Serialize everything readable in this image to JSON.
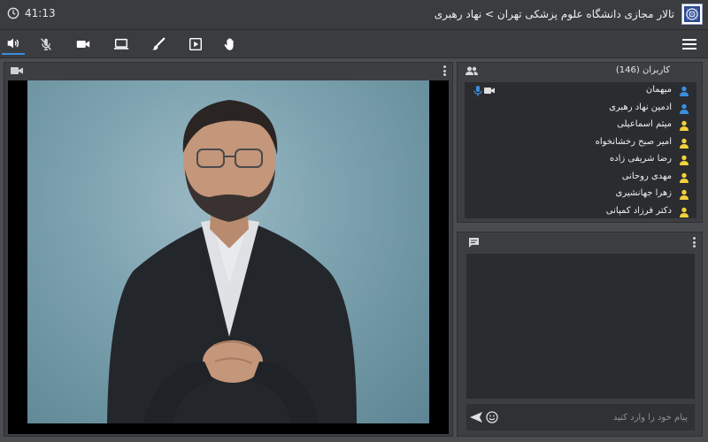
{
  "header": {
    "timer": "41:13",
    "title": "تالار مجازی دانشگاه علوم پزشکی تهران > نهاد رهبری"
  },
  "toolbar": {
    "items": [
      {
        "icon": "speaker-icon",
        "active": true
      },
      {
        "icon": "mic-off-icon",
        "active": false
      },
      {
        "icon": "video-camera-icon",
        "active": false
      },
      {
        "icon": "screen-share-icon",
        "active": false
      },
      {
        "icon": "brush-icon",
        "active": false
      },
      {
        "icon": "presentation-icon",
        "active": false
      },
      {
        "icon": "raise-hand-icon",
        "active": false
      }
    ]
  },
  "users": {
    "title": "کاربران (146)",
    "items": [
      {
        "name": "میهمان",
        "color": "#3b8de0",
        "mic": true,
        "cam": true
      },
      {
        "name": "ادمین نهاد رهبری",
        "color": "#3b8de0",
        "mic": false,
        "cam": false
      },
      {
        "name": "میثم اسماعیلی",
        "color": "#f2d23a",
        "mic": false,
        "cam": false
      },
      {
        "name": "امیر صبح رخشانخواه",
        "color": "#f2d23a",
        "mic": false,
        "cam": false
      },
      {
        "name": "رضا شریفی زاده",
        "color": "#f2d23a",
        "mic": false,
        "cam": false
      },
      {
        "name": "مهدی روحانی",
        "color": "#f2d23a",
        "mic": false,
        "cam": false
      },
      {
        "name": "زهرا جهانشیری",
        "color": "#f2d23a",
        "mic": false,
        "cam": false
      },
      {
        "name": "دکتر فرزاد کمپانی",
        "color": "#f2d23a",
        "mic": false,
        "cam": false
      }
    ]
  },
  "chat": {
    "placeholder": "پیام خود را وارد کنید"
  },
  "colors": {
    "accent": "#3b8de0",
    "user_guest": "#3b8de0",
    "user_member": "#f2d23a"
  }
}
